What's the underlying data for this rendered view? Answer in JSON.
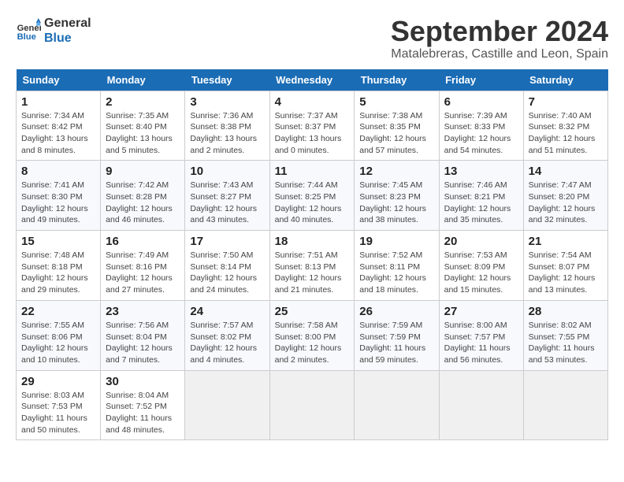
{
  "logo": {
    "line1": "General",
    "line2": "Blue"
  },
  "title": "September 2024",
  "subtitle": "Matalebreras, Castille and Leon, Spain",
  "days_of_week": [
    "Sunday",
    "Monday",
    "Tuesday",
    "Wednesday",
    "Thursday",
    "Friday",
    "Saturday"
  ],
  "weeks": [
    [
      {
        "day": "1",
        "info": "Sunrise: 7:34 AM\nSunset: 8:42 PM\nDaylight: 13 hours\nand 8 minutes."
      },
      {
        "day": "2",
        "info": "Sunrise: 7:35 AM\nSunset: 8:40 PM\nDaylight: 13 hours\nand 5 minutes."
      },
      {
        "day": "3",
        "info": "Sunrise: 7:36 AM\nSunset: 8:38 PM\nDaylight: 13 hours\nand 2 minutes."
      },
      {
        "day": "4",
        "info": "Sunrise: 7:37 AM\nSunset: 8:37 PM\nDaylight: 13 hours\nand 0 minutes."
      },
      {
        "day": "5",
        "info": "Sunrise: 7:38 AM\nSunset: 8:35 PM\nDaylight: 12 hours\nand 57 minutes."
      },
      {
        "day": "6",
        "info": "Sunrise: 7:39 AM\nSunset: 8:33 PM\nDaylight: 12 hours\nand 54 minutes."
      },
      {
        "day": "7",
        "info": "Sunrise: 7:40 AM\nSunset: 8:32 PM\nDaylight: 12 hours\nand 51 minutes."
      }
    ],
    [
      {
        "day": "8",
        "info": "Sunrise: 7:41 AM\nSunset: 8:30 PM\nDaylight: 12 hours\nand 49 minutes."
      },
      {
        "day": "9",
        "info": "Sunrise: 7:42 AM\nSunset: 8:28 PM\nDaylight: 12 hours\nand 46 minutes."
      },
      {
        "day": "10",
        "info": "Sunrise: 7:43 AM\nSunset: 8:27 PM\nDaylight: 12 hours\nand 43 minutes."
      },
      {
        "day": "11",
        "info": "Sunrise: 7:44 AM\nSunset: 8:25 PM\nDaylight: 12 hours\nand 40 minutes."
      },
      {
        "day": "12",
        "info": "Sunrise: 7:45 AM\nSunset: 8:23 PM\nDaylight: 12 hours\nand 38 minutes."
      },
      {
        "day": "13",
        "info": "Sunrise: 7:46 AM\nSunset: 8:21 PM\nDaylight: 12 hours\nand 35 minutes."
      },
      {
        "day": "14",
        "info": "Sunrise: 7:47 AM\nSunset: 8:20 PM\nDaylight: 12 hours\nand 32 minutes."
      }
    ],
    [
      {
        "day": "15",
        "info": "Sunrise: 7:48 AM\nSunset: 8:18 PM\nDaylight: 12 hours\nand 29 minutes."
      },
      {
        "day": "16",
        "info": "Sunrise: 7:49 AM\nSunset: 8:16 PM\nDaylight: 12 hours\nand 27 minutes."
      },
      {
        "day": "17",
        "info": "Sunrise: 7:50 AM\nSunset: 8:14 PM\nDaylight: 12 hours\nand 24 minutes."
      },
      {
        "day": "18",
        "info": "Sunrise: 7:51 AM\nSunset: 8:13 PM\nDaylight: 12 hours\nand 21 minutes."
      },
      {
        "day": "19",
        "info": "Sunrise: 7:52 AM\nSunset: 8:11 PM\nDaylight: 12 hours\nand 18 minutes."
      },
      {
        "day": "20",
        "info": "Sunrise: 7:53 AM\nSunset: 8:09 PM\nDaylight: 12 hours\nand 15 minutes."
      },
      {
        "day": "21",
        "info": "Sunrise: 7:54 AM\nSunset: 8:07 PM\nDaylight: 12 hours\nand 13 minutes."
      }
    ],
    [
      {
        "day": "22",
        "info": "Sunrise: 7:55 AM\nSunset: 8:06 PM\nDaylight: 12 hours\nand 10 minutes."
      },
      {
        "day": "23",
        "info": "Sunrise: 7:56 AM\nSunset: 8:04 PM\nDaylight: 12 hours\nand 7 minutes."
      },
      {
        "day": "24",
        "info": "Sunrise: 7:57 AM\nSunset: 8:02 PM\nDaylight: 12 hours\nand 4 minutes."
      },
      {
        "day": "25",
        "info": "Sunrise: 7:58 AM\nSunset: 8:00 PM\nDaylight: 12 hours\nand 2 minutes."
      },
      {
        "day": "26",
        "info": "Sunrise: 7:59 AM\nSunset: 7:59 PM\nDaylight: 11 hours\nand 59 minutes."
      },
      {
        "day": "27",
        "info": "Sunrise: 8:00 AM\nSunset: 7:57 PM\nDaylight: 11 hours\nand 56 minutes."
      },
      {
        "day": "28",
        "info": "Sunrise: 8:02 AM\nSunset: 7:55 PM\nDaylight: 11 hours\nand 53 minutes."
      }
    ],
    [
      {
        "day": "29",
        "info": "Sunrise: 8:03 AM\nSunset: 7:53 PM\nDaylight: 11 hours\nand 50 minutes."
      },
      {
        "day": "30",
        "info": "Sunrise: 8:04 AM\nSunset: 7:52 PM\nDaylight: 11 hours\nand 48 minutes."
      },
      {
        "day": "",
        "info": ""
      },
      {
        "day": "",
        "info": ""
      },
      {
        "day": "",
        "info": ""
      },
      {
        "day": "",
        "info": ""
      },
      {
        "day": "",
        "info": ""
      }
    ]
  ]
}
